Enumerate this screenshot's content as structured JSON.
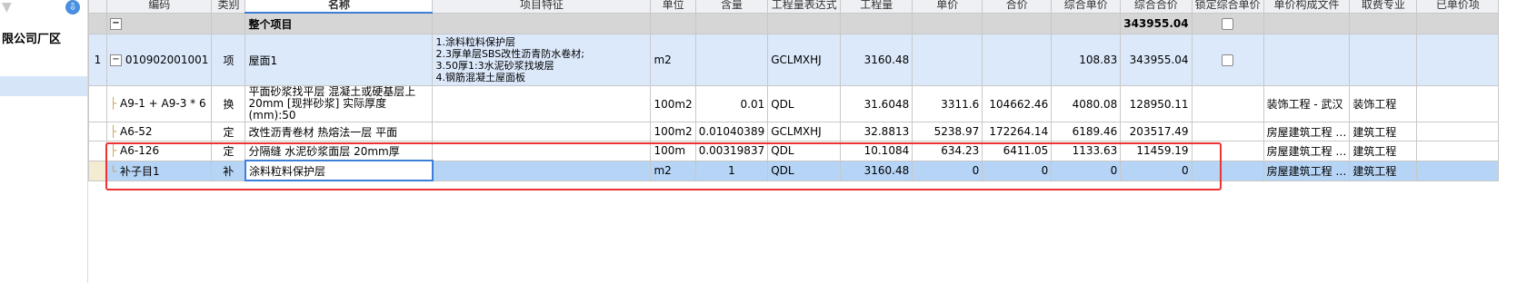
{
  "left_panel": {
    "company": "限公司厂区"
  },
  "headers": [
    "编码",
    "类别",
    "名称",
    "项目特征",
    "单位",
    "含量",
    "工程量表达式",
    "工程量",
    "单价",
    "合价",
    "综合单价",
    "综合合价",
    "锁定综合单价",
    "单价构成文件",
    "取费专业",
    "已单价项"
  ],
  "total_row": {
    "collapse": "−",
    "name": "整个项目",
    "total": "343955.04"
  },
  "main_row": {
    "num": "1",
    "collapse": "−",
    "code": "010902001001",
    "type": "项",
    "name": "屋面1",
    "desc_lines": [
      "1.涂料粒料保护层",
      "2.3厚单层SBS改性沥青防水卷材;",
      "3.50厚1:3水泥砂浆找坡层",
      "4.钢筋混凝土屋面板"
    ],
    "unit": "m2",
    "expr": "GCLMXHJ",
    "qty": "3160.48",
    "unit_price": "108.83",
    "total": "343955.04"
  },
  "rows": [
    {
      "code": "A9-1 + A9-3 * 6",
      "type": "换",
      "name": "平面砂浆找平层 混凝土或硬基层上20mm [现拌砂浆] 实际厚度(mm):50",
      "unit": "100m2",
      "content": "0.01",
      "expr": "QDL",
      "qty": "31.6048",
      "price": "3311.6",
      "amount": "104662.46",
      "unit_price": "4080.08",
      "total": "128950.11",
      "file": "装饰工程 - 武汉",
      "major": "装饰工程"
    },
    {
      "code": "A6-52",
      "type": "定",
      "name": "改性沥青卷材 热熔法一层 平面",
      "unit": "100m2",
      "content": "0.01040389",
      "expr": "GCLMXHJ",
      "qty": "32.8813",
      "price": "5238.97",
      "amount": "172264.14",
      "unit_price": "6189.46",
      "total": "203517.49",
      "file": "房屋建筑工程 …",
      "major": "建筑工程"
    },
    {
      "code": "A6-126",
      "type": "定",
      "name": "分隔缝 水泥砂浆面层 20mm厚",
      "unit": "100m",
      "content": "0.00319837",
      "expr": "QDL",
      "qty": "10.1084",
      "price": "634.23",
      "amount": "6411.05",
      "unit_price": "1133.63",
      "total": "11459.19",
      "file": "房屋建筑工程 …",
      "major": "建筑工程"
    },
    {
      "code": "补子目1",
      "type": "补",
      "name": "涂料粒料保护层",
      "unit": "m2",
      "content": "1",
      "expr": "QDL",
      "qty": "3160.48",
      "price": "0",
      "amount": "0",
      "unit_price": "0",
      "total": "0",
      "file": "房屋建筑工程 …",
      "major": "建筑工程"
    }
  ],
  "colors": {
    "selected_row": "#b6d4f5",
    "main_row": "#dce9fb",
    "total_row": "#d6d6d6",
    "highlight_frame": "#e33333",
    "accent": "#3d7fd8"
  }
}
